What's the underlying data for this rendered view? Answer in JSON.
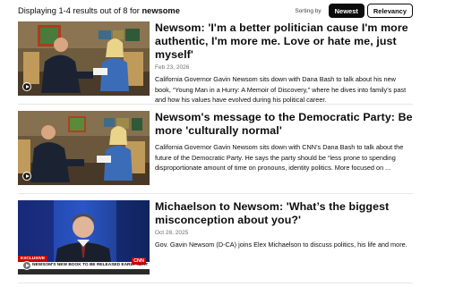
{
  "results": {
    "summary_prefix": "Displaying 1-4 results out of 8 for",
    "query": "newsome",
    "sort_label": "Sorting by",
    "sort_options": [
      "Newest",
      "Relevancy"
    ],
    "active_sort": "Newest"
  },
  "articles": [
    {
      "title": "Newsom: 'I'm a better politician cause I'm more authentic, I'm more me. Love or hate me, just myself'",
      "date": "Feb 23, 2026",
      "description": "California Governor Gavin Newsom sits down with Dana Bash to talk about his new book, “Young Man in a Hurry: A Memoir of Discovery,” where he dives into family’s past and how his values have evolved during his political career.",
      "thumbnail_icon": "interview-thumbnail"
    },
    {
      "title": "Newsom's message to the Democratic Party: Be more 'culturally normal'",
      "date": "Feb 23, 2026",
      "description": "California Governor Gavin Newsom sits down with CNN’s Dana Bash to talk about the future of the Democratic Party. He says the party should be “less prone to spending disproportionate amount of time on pronouns, identity politics. More focused on ...",
      "thumbnail_icon": "interview-thumbnail"
    },
    {
      "title": "Michaelson to Newsom: 'What’s the biggest misconception about you?'",
      "date": "Oct 28, 2025",
      "description": "Gov. Gavin Newsom (D-CA) joins Elex Michaelson to discuss politics, his life and more.",
      "thumbnail_icon": "newscast-thumbnail",
      "ticker_tag": "EXCLUSIVE",
      "ticker_text": "NEWSOM'S NEW BOOK TO BE RELEASED EARLY NEXT YEAR",
      "network_logo": "CNN"
    }
  ],
  "colors": {
    "accent": "#0c0c0c",
    "cnn_red": "#cc0000",
    "date_gray": "#6e6e6e"
  }
}
